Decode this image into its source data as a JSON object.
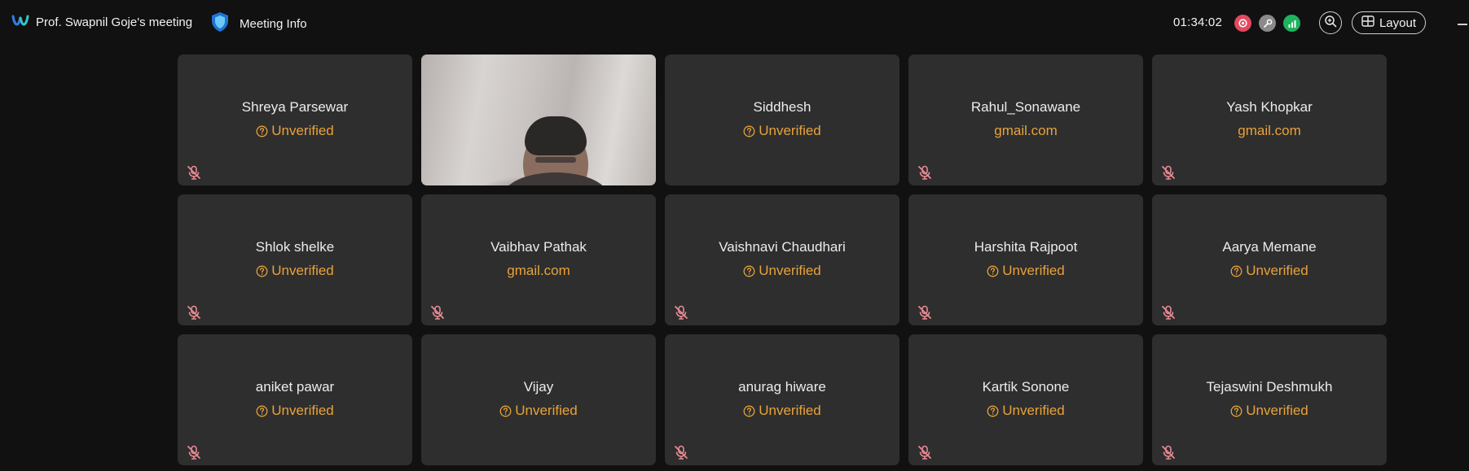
{
  "header": {
    "meeting_title": "Prof. Swapnil Goje's meeting",
    "meeting_info_label": "Meeting Info",
    "timer": "01:34:02",
    "layout_label": "Layout"
  },
  "colors": {
    "background": "#111111",
    "tile": "#2e2e2e",
    "status_text": "#e8a23a",
    "record_dot": "#e3495f",
    "network_dot": "#1fb35f",
    "mute_icon": "#e88a93"
  },
  "participants": [
    {
      "name": "Shreya Parsewar",
      "status": "Unverified",
      "muted": true
    },
    {
      "name": "",
      "status": "",
      "video": true,
      "muted": false
    },
    {
      "name": "Siddhesh",
      "status": "Unverified",
      "muted": false
    },
    {
      "name": "Rahul_Sonawane",
      "status": "gmail.com",
      "muted": true
    },
    {
      "name": "Yash Khopkar",
      "status": "gmail.com",
      "muted": true
    },
    {
      "name": "Shlok shelke",
      "status": "Unverified",
      "muted": true
    },
    {
      "name": "Vaibhav Pathak",
      "status": "gmail.com",
      "muted": true
    },
    {
      "name": "Vaishnavi Chaudhari",
      "status": "Unverified",
      "muted": true
    },
    {
      "name": "Harshita Rajpoot",
      "status": "Unverified",
      "muted": true
    },
    {
      "name": "Aarya Memane",
      "status": "Unverified",
      "muted": true
    },
    {
      "name": "aniket pawar",
      "status": "Unverified",
      "muted": true
    },
    {
      "name": "Vijay",
      "status": "Unverified",
      "muted": false
    },
    {
      "name": "anurag hiware",
      "status": "Unverified",
      "muted": true
    },
    {
      "name": "Kartik Sonone",
      "status": "Unverified",
      "muted": true
    },
    {
      "name": "Tejaswini Deshmukh",
      "status": "Unverified",
      "muted": true
    }
  ]
}
